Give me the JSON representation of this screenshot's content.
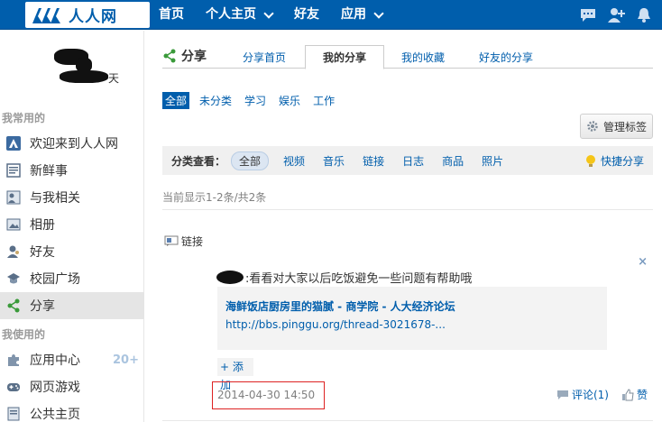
{
  "topbar": {
    "logo_text": "人人网",
    "nav": [
      {
        "label": "首页",
        "has_dropdown": false
      },
      {
        "label": "个人主页",
        "has_dropdown": true
      },
      {
        "label": "好友",
        "has_dropdown": false
      },
      {
        "label": "应用",
        "has_dropdown": true
      }
    ],
    "icons": [
      "chat-icon",
      "add-friend-icon",
      "notification-bell-icon"
    ],
    "background_color": "#005eac"
  },
  "sidebar": {
    "profile_name_suffix": "天",
    "section_frequent": "我常用的",
    "frequent_items": [
      {
        "label": "欢迎来到人人网",
        "icon": "renren-logo-icon"
      },
      {
        "label": "新鲜事",
        "icon": "newsfeed-icon"
      },
      {
        "label": "与我相关",
        "icon": "related-icon"
      },
      {
        "label": "相册",
        "icon": "album-icon"
      },
      {
        "label": "好友",
        "icon": "friends-icon"
      },
      {
        "label": "校园广场",
        "icon": "campus-icon"
      },
      {
        "label": "分享",
        "icon": "share-icon",
        "active": true
      }
    ],
    "section_used": "我使用的",
    "used_items": [
      {
        "label": "应用中心",
        "icon": "app-center-icon",
        "badge": "20+"
      },
      {
        "label": "网页游戏",
        "icon": "game-icon"
      },
      {
        "label": "公共主页",
        "icon": "public-page-icon"
      }
    ]
  },
  "main": {
    "title": "分享",
    "tabs": [
      {
        "label": "分享首页",
        "active": false
      },
      {
        "label": "我的分享",
        "active": true
      },
      {
        "label": "我的收藏",
        "active": false
      },
      {
        "label": "好友的分享",
        "active": false
      }
    ],
    "categories": [
      {
        "label": "全部",
        "active": true
      },
      {
        "label": "未分类",
        "active": false
      },
      {
        "label": "学习",
        "active": false
      },
      {
        "label": "娱乐",
        "active": false
      },
      {
        "label": "工作",
        "active": false
      }
    ],
    "manage_label": "管理标签",
    "filter": {
      "label": "分类查看：",
      "items": [
        {
          "label": "全部",
          "active": true
        },
        {
          "label": "视频",
          "active": false
        },
        {
          "label": "音乐",
          "active": false
        },
        {
          "label": "链接",
          "active": false
        },
        {
          "label": "日志",
          "active": false
        },
        {
          "label": "商品",
          "active": false
        },
        {
          "label": "照片",
          "active": false
        }
      ],
      "quick_share": "快捷分享"
    },
    "count_text": "当前显示1-2条/共2条",
    "post": {
      "type_label": "链接",
      "close": "×",
      "text": ":看看对大家以后吃饭避免一些问题有帮助哦",
      "link_title": "海鲜饭店厨房里的猫腻 - 商学院 - 人大经济论坛",
      "link_url": "http://bbs.pinggu.org/thread-3021678-...",
      "add_label": "+ 添加",
      "timestamp": "2014-04-30 14:50",
      "comment_label": "评论(1)",
      "like_label": "赞"
    }
  }
}
